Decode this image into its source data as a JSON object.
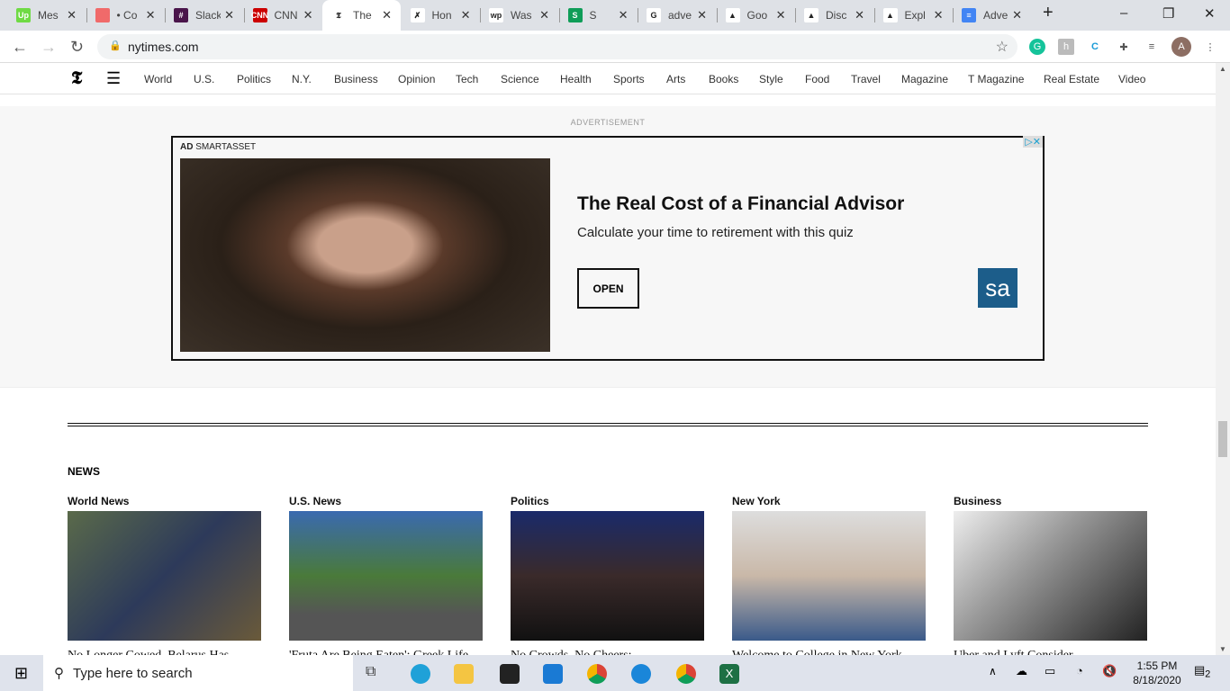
{
  "tabs": [
    {
      "title": "Mes",
      "icon": "upwork-icon",
      "color": "#6fda44",
      "glyph": "Up"
    },
    {
      "title": "• Co",
      "icon": "asana-icon",
      "color": "#f06a6a",
      "glyph": ""
    },
    {
      "title": "Slack",
      "icon": "slack-icon",
      "color": "#4a154b",
      "glyph": "#"
    },
    {
      "title": "CNN",
      "icon": "cnn-icon",
      "color": "#cc0000",
      "glyph": "CNN"
    },
    {
      "title": "The",
      "icon": "nyt-icon",
      "color": "#ffffff",
      "glyph": "𝕿",
      "active": true
    },
    {
      "title": "Hon",
      "icon": "hon-icon",
      "color": "#ffffff",
      "glyph": "✗"
    },
    {
      "title": "Was",
      "icon": "wapo-icon",
      "color": "#ffffff",
      "glyph": "wp"
    },
    {
      "title": "S",
      "icon": "sheets-icon",
      "color": "#0f9d58",
      "glyph": "S"
    },
    {
      "title": "adve",
      "icon": "google-icon",
      "color": "#ffffff",
      "glyph": "G"
    },
    {
      "title": "Goo",
      "icon": "google-ads-icon",
      "color": "#ffffff",
      "glyph": "▲"
    },
    {
      "title": "Disc",
      "icon": "google-ads-icon",
      "color": "#ffffff",
      "glyph": "▲"
    },
    {
      "title": "Expl",
      "icon": "google-ads-icon",
      "color": "#ffffff",
      "glyph": "▲"
    },
    {
      "title": "Adve",
      "icon": "docs-icon",
      "color": "#4285f4",
      "glyph": "≡"
    }
  ],
  "url": "nytimes.com",
  "profile_initial": "A",
  "nav": [
    "World",
    "U.S.",
    "Politics",
    "N.Y.",
    "Business",
    "Opinion",
    "Tech",
    "Science",
    "Health",
    "Sports",
    "Arts",
    "Books",
    "Style",
    "Food",
    "Travel",
    "Magazine",
    "T Magazine",
    "Real Estate",
    "Video"
  ],
  "ad": {
    "label": "ADVERTISEMENT",
    "tag": "AD",
    "sponsor": "SMARTASSET",
    "headline": "The Real Cost of a Financial Advisor",
    "sub": "Calculate your time to retirement with this quiz",
    "cta": "OPEN",
    "logo": "sa"
  },
  "news": {
    "title": "NEWS",
    "columns": [
      {
        "section": "World News",
        "headline": "No Longer Cowed, Belarus Has"
      },
      {
        "section": "U.S. News",
        "headline": "'Fruta Are Being Eaten': Greek Life"
      },
      {
        "section": "Politics",
        "headline": "No Crowds, No Cheers:"
      },
      {
        "section": "New York",
        "headline": "Welcome to College in New York"
      },
      {
        "section": "Business",
        "headline": "Uber and Lyft Consider"
      }
    ]
  },
  "taskbar": {
    "search_placeholder": "Type here to search",
    "time": "1:55 PM",
    "date": "8/18/2020",
    "notifications": "2"
  }
}
